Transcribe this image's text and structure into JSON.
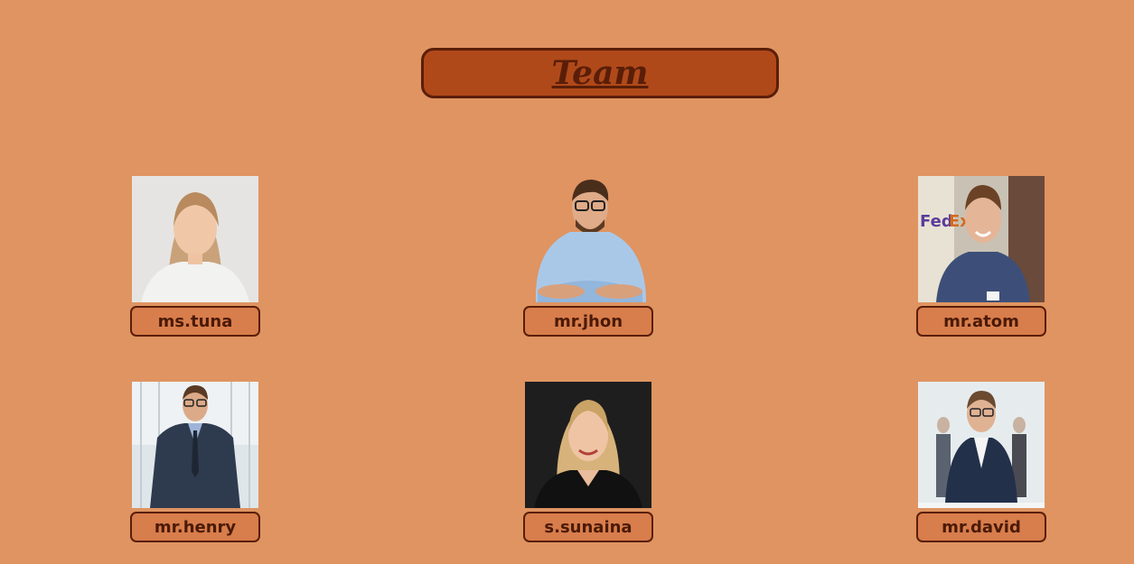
{
  "page": {
    "title": "Team"
  },
  "members": [
    {
      "name": "ms.tuna",
      "photo": "woman-blonde-portrait"
    },
    {
      "name": "mr.jhon",
      "photo": "man-glasses-arms-crossed"
    },
    {
      "name": "mr.atom",
      "photo": "man-smiling-fedex"
    },
    {
      "name": "mr.henry",
      "photo": "man-suit-glasses"
    },
    {
      "name": "s.sunaina",
      "photo": "woman-blonde-dark-bg"
    },
    {
      "name": "mr.david",
      "photo": "man-glasses-team"
    }
  ],
  "colors": {
    "background": "#df9461",
    "title_fill": "#b0491a",
    "border": "#5a1e08",
    "tag_fill": "#d87d4c"
  }
}
